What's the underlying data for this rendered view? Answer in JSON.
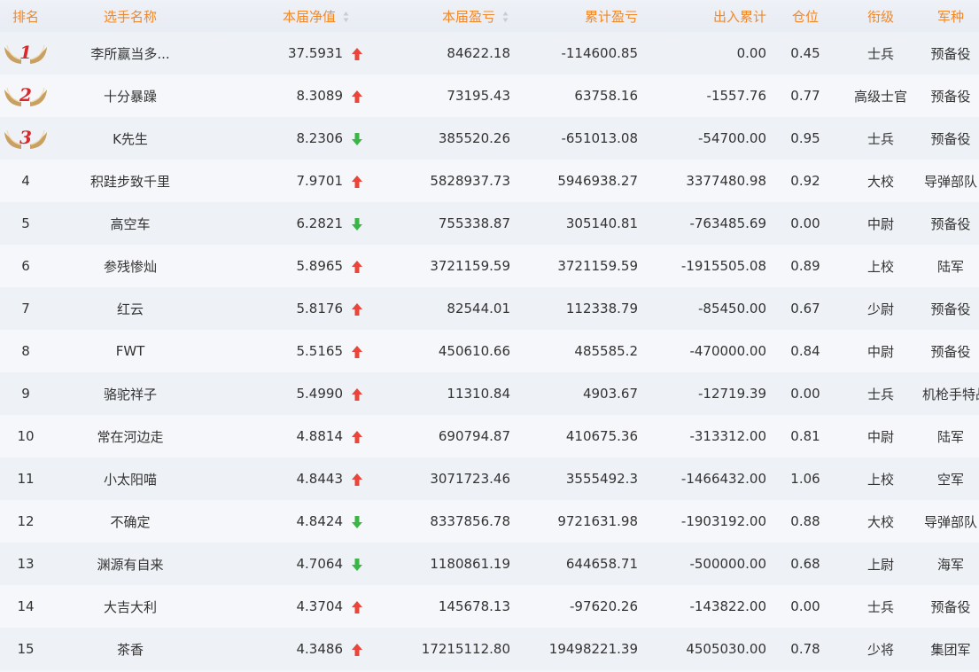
{
  "columns": {
    "rank": "排名",
    "name": "选手名称",
    "nav": "本届净值",
    "pnl": "本届盈亏",
    "cum_pnl": "累计盈亏",
    "flow": "出入累计",
    "position": "仓位",
    "title": "衔级",
    "branch": "军种"
  },
  "colors": {
    "header_text": "#f0882a",
    "up": "#e8463a",
    "down": "#3cb446",
    "medal_wing": "#c8a064",
    "medal_number": "#d8282a"
  },
  "rows": [
    {
      "rank": "1",
      "medal": true,
      "name": "李所赢当多...",
      "nav": "37.5931",
      "trend": "up",
      "pnl": "84622.18",
      "cum_pnl": "-114600.85",
      "flow": "0.00",
      "position": "0.45",
      "title": "士兵",
      "branch": "预备役"
    },
    {
      "rank": "2",
      "medal": true,
      "name": "十分暴躁",
      "nav": "8.3089",
      "trend": "up",
      "pnl": "73195.43",
      "cum_pnl": "63758.16",
      "flow": "-1557.76",
      "position": "0.77",
      "title": "高级士官",
      "branch": "预备役"
    },
    {
      "rank": "3",
      "medal": true,
      "name": "K先生",
      "nav": "8.2306",
      "trend": "down",
      "pnl": "385520.26",
      "cum_pnl": "-651013.08",
      "flow": "-54700.00",
      "position": "0.95",
      "title": "士兵",
      "branch": "预备役"
    },
    {
      "rank": "4",
      "medal": false,
      "name": "积跬步致千里",
      "nav": "7.9701",
      "trend": "up",
      "pnl": "5828937.73",
      "cum_pnl": "5946938.27",
      "flow": "3377480.98",
      "position": "0.92",
      "title": "大校",
      "branch": "导弹部队"
    },
    {
      "rank": "5",
      "medal": false,
      "name": "高空车",
      "nav": "6.2821",
      "trend": "down",
      "pnl": "755338.87",
      "cum_pnl": "305140.81",
      "flow": "-763485.69",
      "position": "0.00",
      "title": "中尉",
      "branch": "预备役"
    },
    {
      "rank": "6",
      "medal": false,
      "name": "参残惨灿",
      "nav": "5.8965",
      "trend": "up",
      "pnl": "3721159.59",
      "cum_pnl": "3721159.59",
      "flow": "-1915505.08",
      "position": "0.89",
      "title": "上校",
      "branch": "陆军"
    },
    {
      "rank": "7",
      "medal": false,
      "name": "红云",
      "nav": "5.8176",
      "trend": "up",
      "pnl": "82544.01",
      "cum_pnl": "112338.79",
      "flow": "-85450.00",
      "position": "0.67",
      "title": "少尉",
      "branch": "预备役"
    },
    {
      "rank": "8",
      "medal": false,
      "name": "FWT",
      "nav": "5.5165",
      "trend": "up",
      "pnl": "450610.66",
      "cum_pnl": "485585.2",
      "flow": "-470000.00",
      "position": "0.84",
      "title": "中尉",
      "branch": "预备役"
    },
    {
      "rank": "9",
      "medal": false,
      "name": "骆驼祥子",
      "nav": "5.4990",
      "trend": "up",
      "pnl": "11310.84",
      "cum_pnl": "4903.67",
      "flow": "-12719.39",
      "position": "0.00",
      "title": "士兵",
      "branch": "机枪手特战营"
    },
    {
      "rank": "10",
      "medal": false,
      "name": "常在河边走",
      "nav": "4.8814",
      "trend": "up",
      "pnl": "690794.87",
      "cum_pnl": "410675.36",
      "flow": "-313312.00",
      "position": "0.81",
      "title": "中尉",
      "branch": "陆军"
    },
    {
      "rank": "11",
      "medal": false,
      "name": "小太阳喵",
      "nav": "4.8443",
      "trend": "up",
      "pnl": "3071723.46",
      "cum_pnl": "3555492.3",
      "flow": "-1466432.00",
      "position": "1.06",
      "title": "上校",
      "branch": "空军"
    },
    {
      "rank": "12",
      "medal": false,
      "name": "不确定",
      "nav": "4.8424",
      "trend": "down",
      "pnl": "8337856.78",
      "cum_pnl": "9721631.98",
      "flow": "-1903192.00",
      "position": "0.88",
      "title": "大校",
      "branch": "导弹部队"
    },
    {
      "rank": "13",
      "medal": false,
      "name": "渊源有自来",
      "nav": "4.7064",
      "trend": "down",
      "pnl": "1180861.19",
      "cum_pnl": "644658.71",
      "flow": "-500000.00",
      "position": "0.68",
      "title": "上尉",
      "branch": "海军"
    },
    {
      "rank": "14",
      "medal": false,
      "name": "大吉大利",
      "nav": "4.3704",
      "trend": "up",
      "pnl": "145678.13",
      "cum_pnl": "-97620.26",
      "flow": "-143822.00",
      "position": "0.00",
      "title": "士兵",
      "branch": "预备役"
    },
    {
      "rank": "15",
      "medal": false,
      "name": "茶香",
      "nav": "4.3486",
      "trend": "up",
      "pnl": "17215112.80",
      "cum_pnl": "19498221.39",
      "flow": "4505030.00",
      "position": "0.78",
      "title": "少将",
      "branch": "集团军"
    }
  ]
}
